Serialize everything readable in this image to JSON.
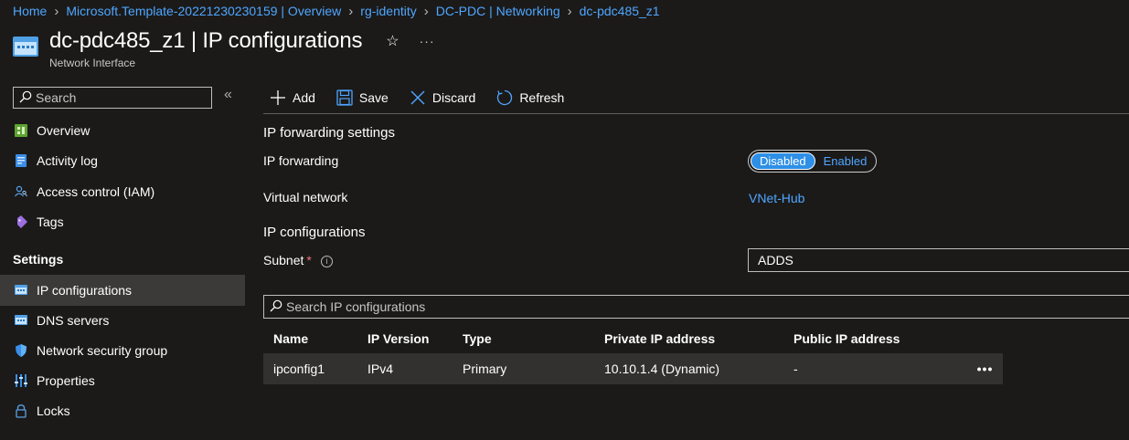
{
  "breadcrumb": [
    "Home",
    "Microsoft.Template-20221230230159 | Overview",
    "rg-identity",
    "DC-PDC | Networking",
    "dc-pdc485_z1"
  ],
  "header": {
    "title": "dc-pdc485_z1 | IP configurations",
    "subtitle": "Network Interface",
    "star": "☆",
    "more": "···"
  },
  "sidebar": {
    "search_placeholder": "Search",
    "collapse": "«",
    "items": [
      {
        "label": "Overview",
        "icon": "overview-icon"
      },
      {
        "label": "Activity log",
        "icon": "activity-log-icon"
      },
      {
        "label": "Access control (IAM)",
        "icon": "iam-icon"
      },
      {
        "label": "Tags",
        "icon": "tag-icon"
      }
    ],
    "settings_title": "Settings",
    "settings_items": [
      {
        "label": "IP configurations",
        "icon": "ip-config-icon",
        "selected": true
      },
      {
        "label": "DNS servers",
        "icon": "dns-icon"
      },
      {
        "label": "Network security group",
        "icon": "shield-icon"
      },
      {
        "label": "Properties",
        "icon": "properties-icon"
      },
      {
        "label": "Locks",
        "icon": "lock-icon"
      }
    ]
  },
  "toolbar": {
    "add": "Add",
    "save": "Save",
    "discard": "Discard",
    "refresh": "Refresh"
  },
  "forwarding": {
    "section": "IP forwarding settings",
    "label": "IP forwarding",
    "disabled": "Disabled",
    "enabled": "Enabled",
    "value": "Disabled"
  },
  "vnet": {
    "label": "Virtual network",
    "value": "VNet-Hub"
  },
  "ipconfig": {
    "section": "IP configurations",
    "subnet_label": "Subnet",
    "required": "*",
    "subnet_value": "ADDS",
    "search_placeholder": "Search IP configurations"
  },
  "table": {
    "headers": [
      "Name",
      "IP Version",
      "Type",
      "Private IP address",
      "Public IP address"
    ],
    "rows": [
      {
        "name": "ipconfig1",
        "version": "IPv4",
        "type": "Primary",
        "private_ip": "10.10.1.4 (Dynamic)",
        "public_ip": "-",
        "more": "•••"
      }
    ]
  },
  "colors": {
    "background": "#1b1a19",
    "link": "#4fa6ff",
    "toggle_on": "#2e8fe6",
    "selected_row": "#3b3a39"
  }
}
